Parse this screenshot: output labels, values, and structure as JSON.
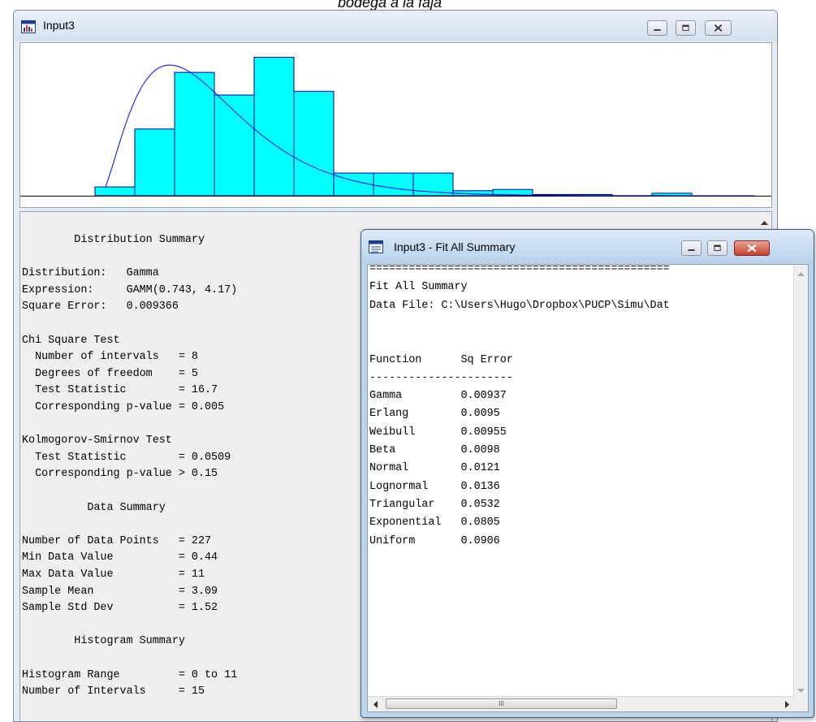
{
  "caption": "bodega a la faja",
  "main_window": {
    "title": "Input3",
    "histogram": {
      "bars": [
        0.07,
        0.53,
        0.98,
        0.8,
        1.1,
        0.83,
        0.18,
        0.18,
        0.18,
        0.04,
        0.05,
        0.01,
        0.01,
        0.0,
        0.02
      ],
      "bar_color": "#00ffff",
      "curve_color": "#0000ff"
    },
    "summary_lines": [
      "        Distribution Summary",
      "",
      "Distribution:   Gamma",
      "Expression:     GAMM(0.743, 4.17)",
      "Square Error:   0.009366",
      "",
      "Chi Square Test",
      "  Number of intervals   = 8",
      "  Degrees of freedom    = 5",
      "  Test Statistic        = 16.7",
      "  Corresponding p-value = 0.005",
      "",
      "Kolmogorov-Smirnov Test",
      "  Test Statistic        = 0.0509",
      "  Corresponding p-value > 0.15",
      "",
      "          Data Summary",
      "",
      "Number of Data Points   = 227",
      "Min Data Value          = 0.44",
      "Max Data Value          = 11",
      "Sample Mean             = 3.09",
      "Sample Std Dev          = 1.52",
      "",
      "        Histogram Summary",
      "",
      "Histogram Range         = 0 to 11",
      "Number of Intervals     = 15"
    ]
  },
  "fit_window": {
    "title": "Input3 - Fit All Summary",
    "lines": [
      "==============================================",
      "Fit All Summary",
      "Data File: C:\\Users\\Hugo\\Dropbox\\PUCP\\Simu\\Dat",
      "",
      "",
      "Function      Sq Error",
      "----------------------",
      "Gamma         0.00937",
      "Erlang        0.0095",
      "Weibull       0.00955",
      "Beta          0.0098",
      "Normal        0.0121",
      "Lognormal     0.0136",
      "Triangular    0.0532",
      "Exponential   0.0805",
      "Uniform       0.0906"
    ],
    "scroll_thumb_glyph": "III"
  }
}
